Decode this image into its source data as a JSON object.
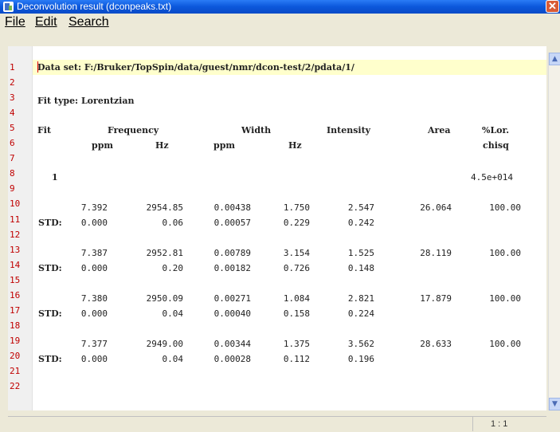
{
  "window": {
    "title": "Deconvolution result (dconpeaks.txt)"
  },
  "menu": {
    "file": "File",
    "edit": "Edit",
    "search": "Search"
  },
  "editor": {
    "line_numbers": [
      "1",
      "2",
      "3",
      "4",
      "5",
      "6",
      "7",
      "8",
      "9",
      "10",
      "11",
      "12",
      "13",
      "14",
      "15",
      "16",
      "17",
      "18",
      "19",
      "20",
      "21",
      "22"
    ],
    "data_set": "Data set: F:/Bruker/TopSpin/data/guest/nmr/dcon-test/2/pdata/1/",
    "fit_type": "Fit type: Lorentzian",
    "header1": {
      "fit": "Fit",
      "frequency": "Frequency",
      "width": "Width",
      "intensity": "Intensity",
      "area": "Area",
      "lor": "%Lor."
    },
    "header2": {
      "ppm1": "ppm",
      "hz1": "Hz",
      "ppm2": "ppm",
      "hz2": "Hz",
      "chisq": "chisq"
    },
    "fit_no": "1",
    "chisq_value": "4.5e+014",
    "peaks": [
      {
        "values": [
          "7.392",
          "2954.85",
          "0.00438",
          "1.750",
          "2.547",
          "26.064",
          "100.00"
        ],
        "std": [
          "0.000",
          "0.06",
          "0.00057",
          "0.229",
          "0.242"
        ]
      },
      {
        "values": [
          "7.387",
          "2952.81",
          "0.00789",
          "3.154",
          "1.525",
          "28.119",
          "100.00"
        ],
        "std": [
          "0.000",
          "0.20",
          "0.00182",
          "0.726",
          "0.148"
        ]
      },
      {
        "values": [
          "7.380",
          "2950.09",
          "0.00271",
          "1.084",
          "2.821",
          "17.879",
          "100.00"
        ],
        "std": [
          "0.000",
          "0.04",
          "0.00040",
          "0.158",
          "0.224"
        ]
      },
      {
        "values": [
          "7.377",
          "2949.00",
          "0.00344",
          "1.375",
          "3.562",
          "28.633",
          "100.00"
        ],
        "std": [
          "0.000",
          "0.04",
          "0.00028",
          "0.112",
          "0.196"
        ]
      }
    ],
    "std_label": "STD:"
  },
  "status": {
    "position": "1 : 1"
  },
  "icons": {
    "app": "document-icon",
    "close": "close-icon",
    "scroll_up": "arrow-up-icon",
    "scroll_down": "arrow-down-icon"
  }
}
